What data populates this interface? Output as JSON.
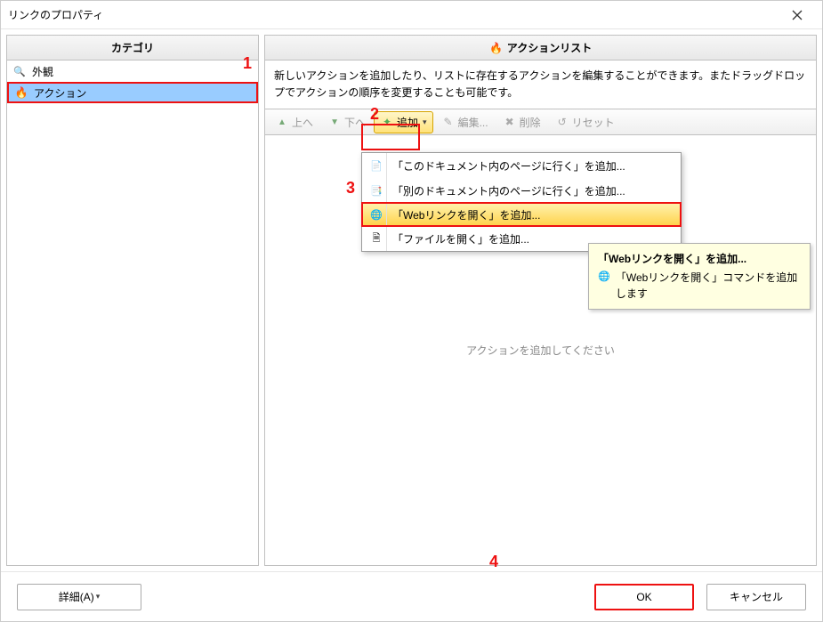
{
  "window": {
    "title": "リンクのプロパティ"
  },
  "left_panel": {
    "header": "カテゴリ",
    "items": [
      {
        "label": "外観",
        "icon": "magnifier",
        "selected": false
      },
      {
        "label": "アクション",
        "icon": "spark",
        "selected": true
      }
    ]
  },
  "right_panel": {
    "header": "アクションリスト",
    "description": "新しいアクションを追加したり、リストに存在するアクションを編集することができます。またドラッグドロップでアクションの順序を変更することも可能です。",
    "toolbar": {
      "up": "上へ",
      "down": "下へ",
      "add": "追加",
      "edit": "編集...",
      "delete": "削除",
      "reset": "リセット"
    },
    "placeholder": "アクションを追加してください",
    "add_menu": [
      {
        "label": "「このドキュメント内のページに行く」を追加...",
        "icon": "page"
      },
      {
        "label": "「別のドキュメント内のページに行く」を追加...",
        "icon": "pagearrow"
      },
      {
        "label": "「Webリンクを開く」を追加...",
        "icon": "globe",
        "hover": true
      },
      {
        "label": "「ファイルを開く」を追加...",
        "icon": "file"
      }
    ],
    "tooltip": {
      "title": "「Webリンクを開く」を追加...",
      "body": "「Webリンクを開く」コマンドを追加します"
    }
  },
  "footer": {
    "details": "詳細(A)",
    "ok": "OK",
    "cancel": "キャンセル"
  },
  "annotations": {
    "n1": "1",
    "n2": "2",
    "n3": "3",
    "n4": "4"
  }
}
